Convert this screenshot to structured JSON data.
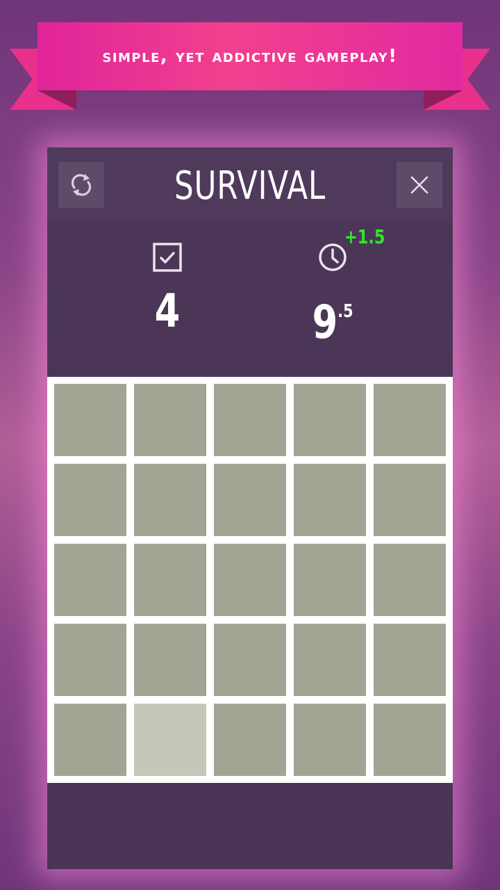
{
  "banner": {
    "text": "Simple, yet addictive gameplay!"
  },
  "header": {
    "title": "SURVIVAL",
    "restart_icon": "restart-icon",
    "close_icon": "close-icon"
  },
  "stats": {
    "score": {
      "icon": "checkbox-icon",
      "value": "4"
    },
    "time": {
      "icon": "clock-icon",
      "value_main": "9",
      "value_decimal": ".5",
      "bonus": "+1.5"
    }
  },
  "board": {
    "rows": 5,
    "cols": 5,
    "odd_tile": {
      "row": 5,
      "col": 2
    },
    "tile_color": "#a3a594",
    "odd_tile_color": "#c6c7b9"
  },
  "colors": {
    "panel": "#4a3557",
    "ribbon": "#e9318c",
    "bonus": "#2ee62b"
  }
}
